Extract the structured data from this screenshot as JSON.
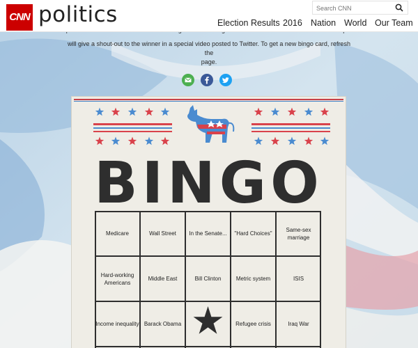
{
  "header": {
    "logo_text": "CNN",
    "section_title": "politics",
    "search_placeholder": "Search CNN",
    "nav": [
      "Election Results",
      "2016",
      "Nation",
      "World",
      "Our Team"
    ]
  },
  "intro": {
    "line1": "person to tweet a screenshot of a winning card with \"Bingo!\" to #DemDebate will win. Anderson Cooper",
    "line2": "will give a shout-out to the winner in a special video posted to Twitter. To get a new bingo card, refresh the",
    "line3": "page."
  },
  "share": [
    {
      "icon": "email-icon",
      "color": "#4caf50"
    },
    {
      "icon": "facebook-icon",
      "color": "#3b5998"
    },
    {
      "icon": "twitter-icon",
      "color": "#1da1f2"
    }
  ],
  "card": {
    "title": "BINGO",
    "star_colors": [
      "#4a8bd0",
      "#d9424b"
    ],
    "free_space": "star-icon",
    "cells": [
      [
        "Medicare",
        "Wall Street",
        "In the Senate...",
        "\"Hard Choices\"",
        "Same-sex marriage"
      ],
      [
        "Hard-working Americans",
        "Middle East",
        "Bill Clinton",
        "Metric system",
        "ISIS"
      ],
      [
        "Income inequality",
        "Barack Obama",
        "",
        "Refugee crisis",
        "Iraq War"
      ]
    ]
  }
}
